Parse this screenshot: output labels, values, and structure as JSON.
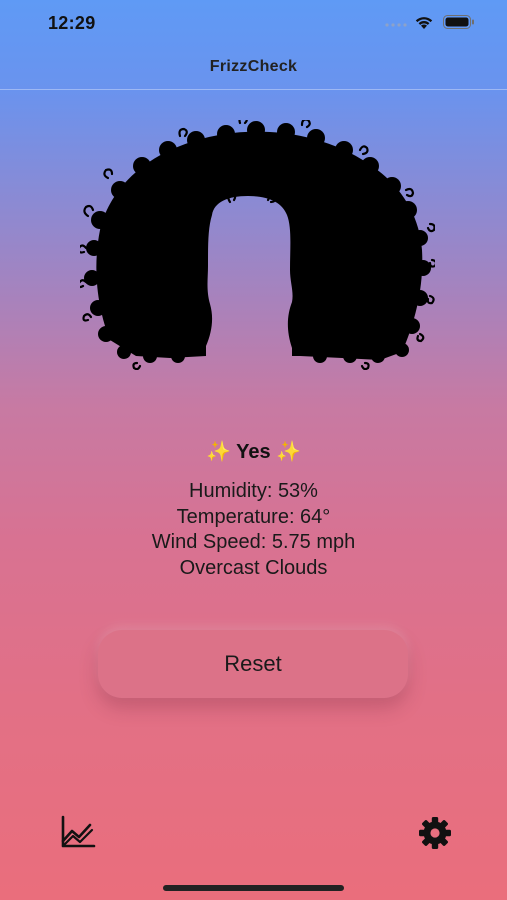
{
  "status_bar": {
    "time": "12:29",
    "icons": [
      "signal-dots-icon",
      "wifi-icon",
      "battery-icon"
    ]
  },
  "nav": {
    "title": "FrizzCheck"
  },
  "hero": {
    "icon": "curly-hair-silhouette-icon"
  },
  "result": {
    "sparkle_left": "✨",
    "answer": "Yes",
    "sparkle_right": "✨"
  },
  "weather": {
    "humidity": "Humidity: 53%",
    "temperature": "Temperature: 64°",
    "wind_speed": "Wind Speed: 5.75 mph",
    "conditions": "Overcast Clouds"
  },
  "actions": {
    "reset_label": "Reset"
  },
  "toolbar": {
    "left_icon": "chart-icon",
    "right_icon": "gear-icon"
  },
  "colors": {
    "gradient_top": "#5f9af5",
    "gradient_mid": "#c77aa3",
    "gradient_bottom": "#ea6e7c",
    "button_fill": "#dc7288",
    "sparkle": "#f6c944"
  }
}
